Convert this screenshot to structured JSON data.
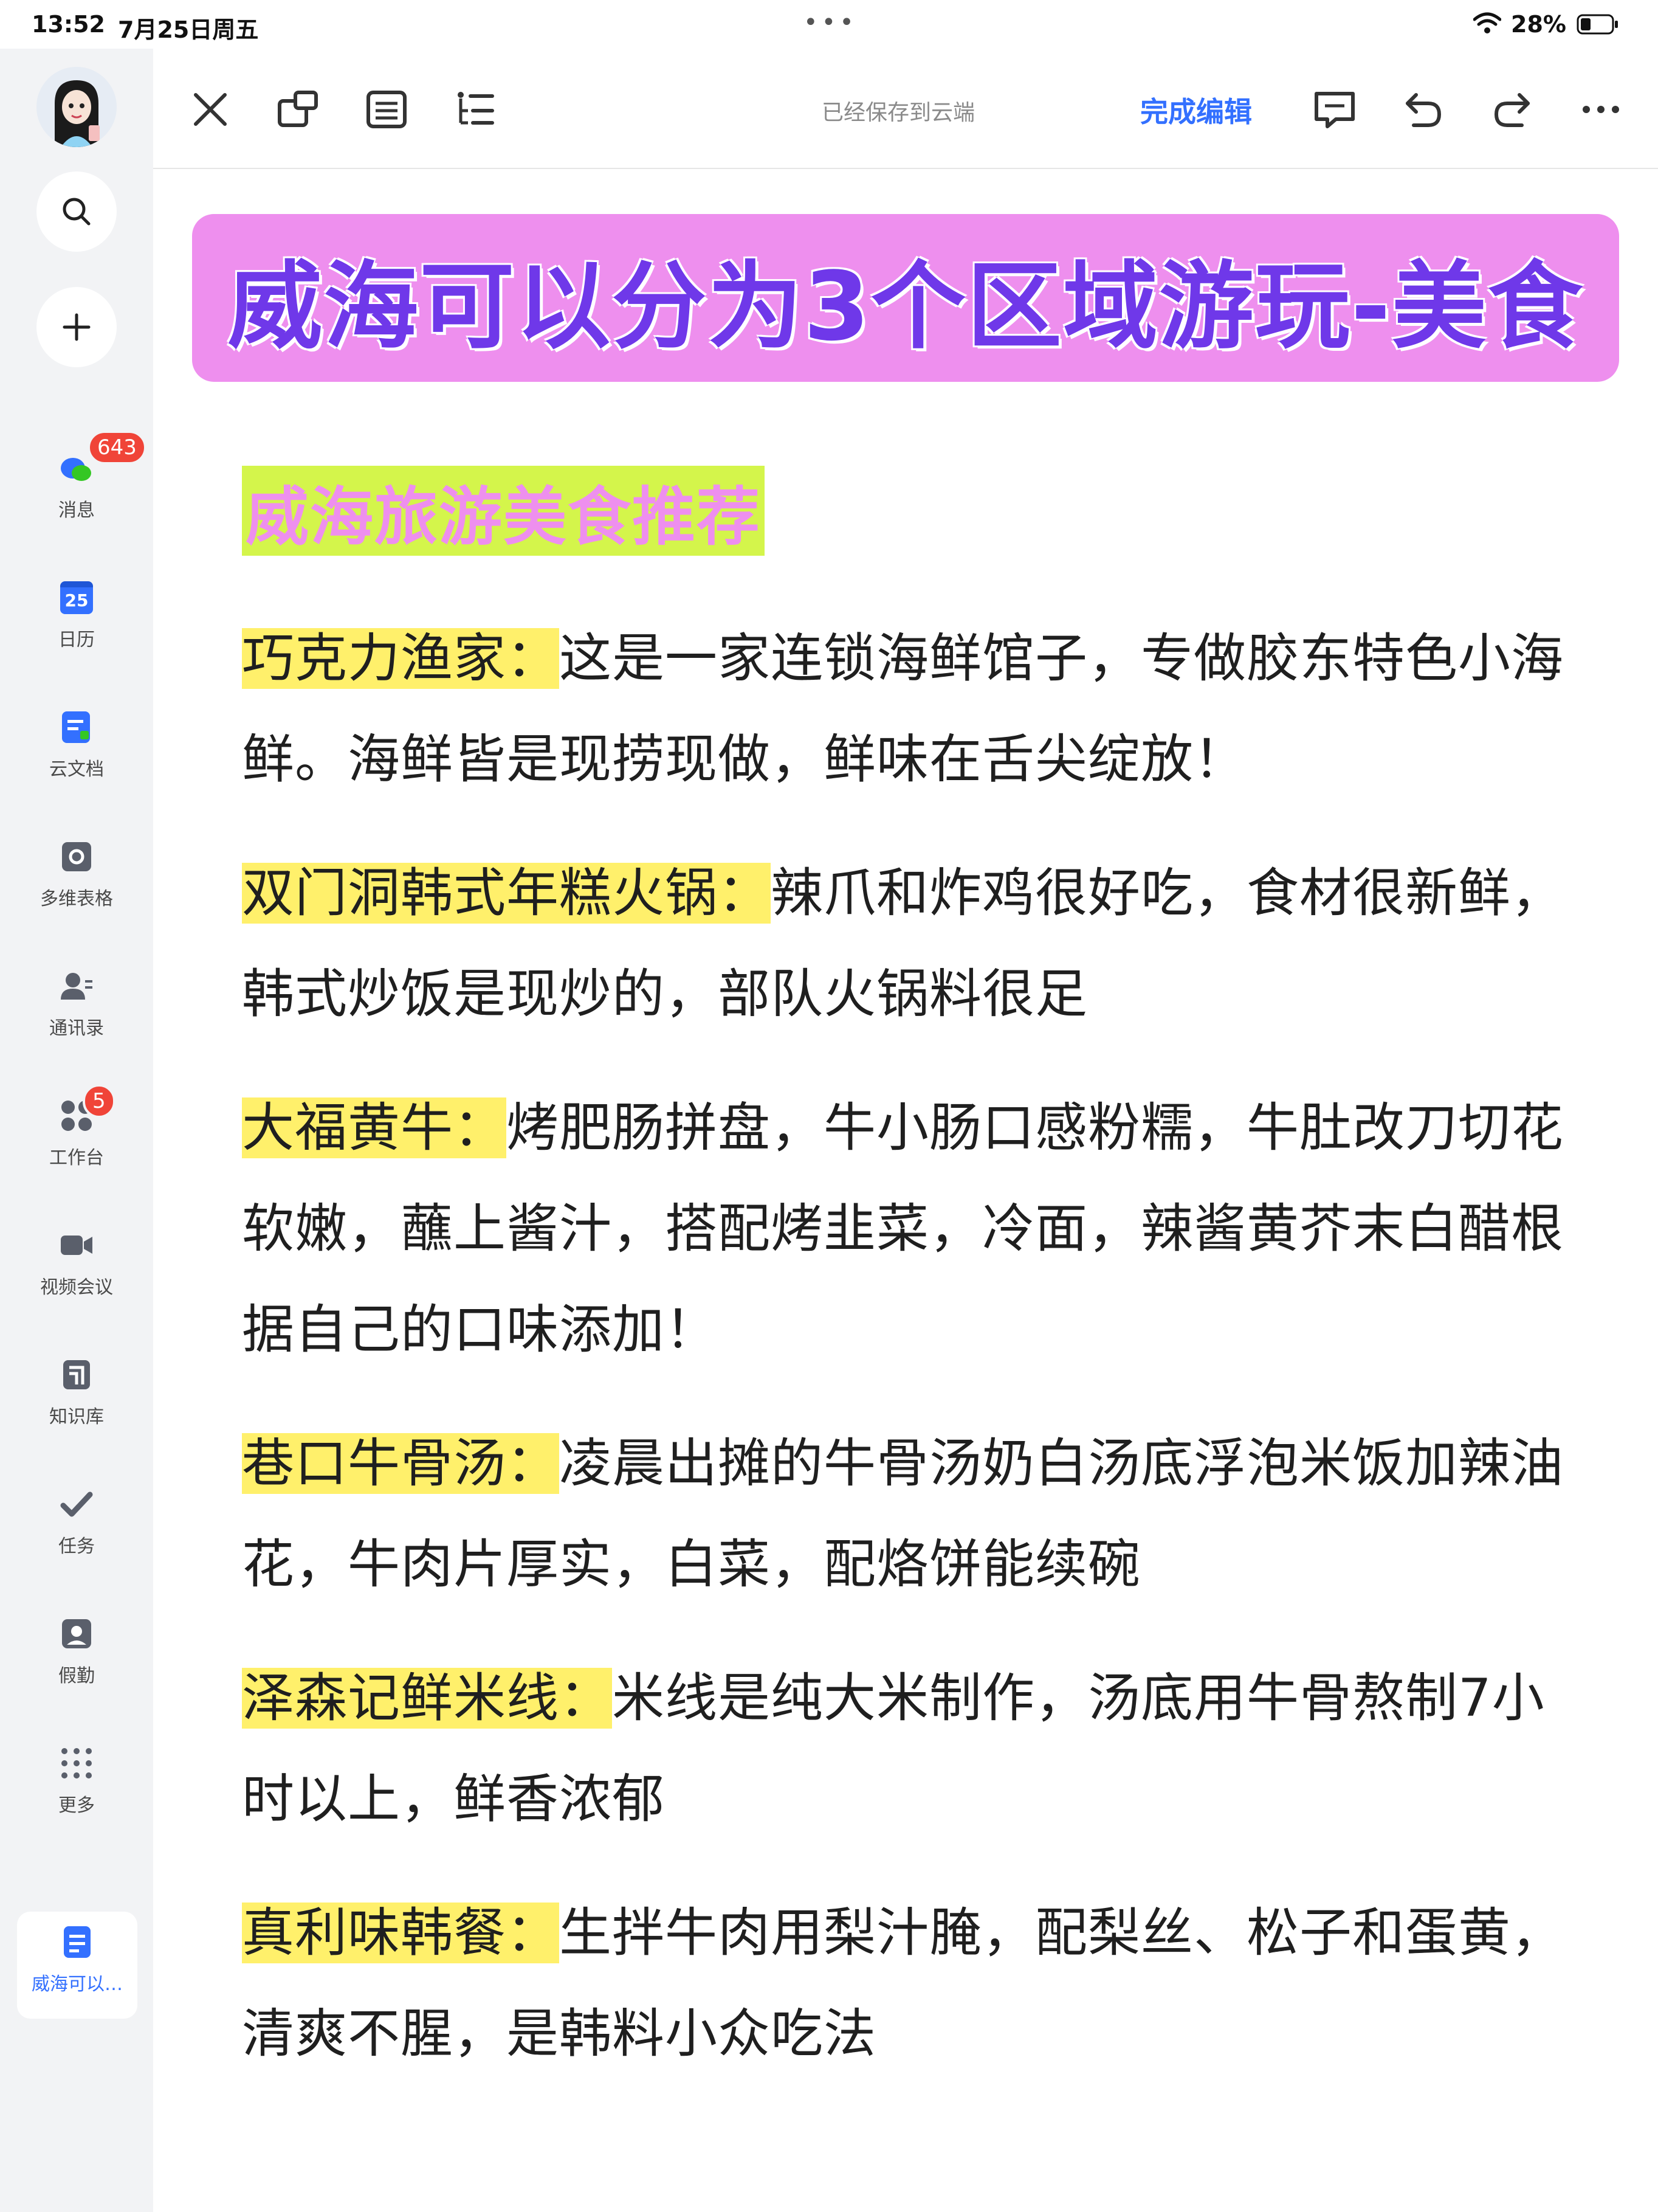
{
  "status_bar": {
    "time": "13:52",
    "date": "7月25日周五",
    "battery": "28%"
  },
  "sidebar": {
    "messages": {
      "label": "消息",
      "badge": "643"
    },
    "calendar": {
      "label": "日历",
      "day": "25"
    },
    "docs": {
      "label": "云文档"
    },
    "sheets": {
      "label": "多维表格"
    },
    "contacts": {
      "label": "通讯录"
    },
    "workbench": {
      "label": "工作台",
      "badge": "5"
    },
    "video": {
      "label": "视频会议"
    },
    "wiki": {
      "label": "知识库"
    },
    "tasks": {
      "label": "任务"
    },
    "leave": {
      "label": "假勤"
    },
    "more": {
      "label": "更多"
    },
    "current_doc": {
      "label": "威海可以…"
    }
  },
  "toolbar": {
    "save_status": "已经保存到云端",
    "done_label": "完成编辑"
  },
  "document": {
    "banner_title": "威海可以分为3个区域游玩-美食",
    "section_heading": "威海旅游美食推荐",
    "entries": [
      {
        "name": "巧克力渔家：",
        "desc": "这是一家连锁海鲜馆子，专做胶东特色小海鲜。海鲜皆是现捞现做，鲜味在舌尖绽放！"
      },
      {
        "name": "双门洞韩式年糕火锅：",
        "desc": "辣爪和炸鸡很好吃，食材很新鲜，韩式炒饭是现炒的，部队火锅料很足"
      },
      {
        "name": "大福黄牛：",
        "desc": "烤肥肠拼盘，牛小肠口感粉糯，牛肚改刀切花软嫩，蘸上酱汁，搭配烤韭菜，冷面，辣酱黄芥末白醋根据自己的口味添加！"
      },
      {
        "name": "巷口牛骨汤：",
        "desc": "凌晨出摊的牛骨汤奶白汤底浮泡米饭加辣油花，牛肉片厚实，白菜，配烙饼能续碗"
      },
      {
        "name": "泽森记鲜米线：",
        "desc": "米线是纯大米制作，汤底用牛骨熬制7小时以上，鲜香浓郁"
      },
      {
        "name": "真利味韩餐：",
        "desc": "生拌牛肉用梨汁腌，配梨丝、松子和蛋黄，清爽不腥，是韩料小众吃法"
      }
    ]
  },
  "colors": {
    "accent": "#3370ff",
    "banner_bg": "#ee8fee",
    "banner_text": "#6f38e9",
    "heading_bg": "#d4f54b",
    "name_highlight": "#fff06b",
    "badge": "#f04438"
  }
}
